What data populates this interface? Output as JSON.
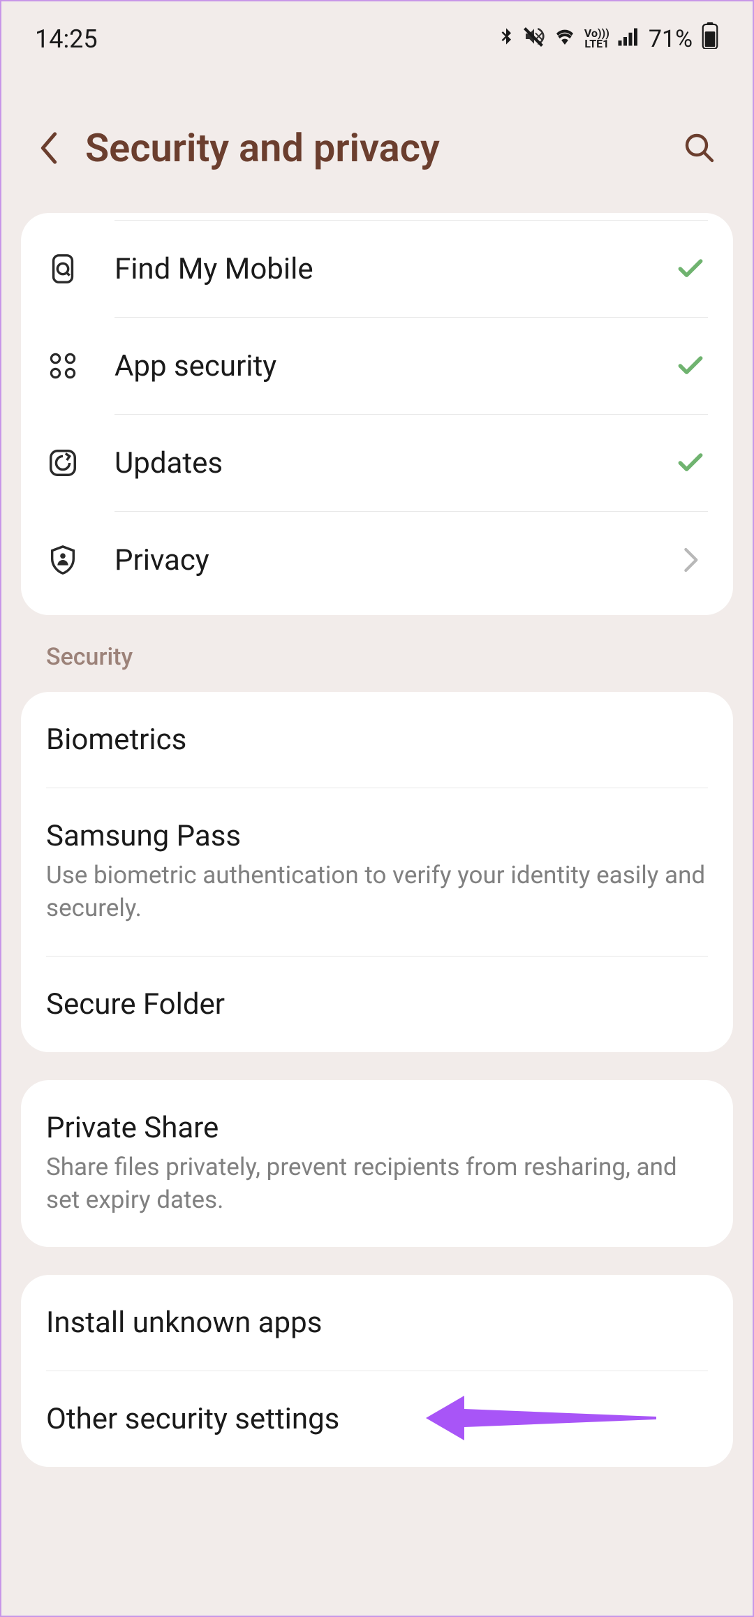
{
  "statusBar": {
    "time": "14:25",
    "battery": "71%"
  },
  "header": {
    "title": "Security and privacy"
  },
  "card1": {
    "items": [
      {
        "label": "Find My Mobile",
        "icon": "find-mobile",
        "status": "check"
      },
      {
        "label": "App security",
        "icon": "apps",
        "status": "check"
      },
      {
        "label": "Updates",
        "icon": "updates",
        "status": "check"
      },
      {
        "label": "Privacy",
        "icon": "privacy",
        "status": "chevron"
      }
    ]
  },
  "sectionHeader": "Security",
  "card2": {
    "items": [
      {
        "label": "Biometrics",
        "desc": ""
      },
      {
        "label": "Samsung Pass",
        "desc": "Use biometric authentication to verify your identity easily and securely."
      },
      {
        "label": "Secure Folder",
        "desc": ""
      }
    ]
  },
  "card3": {
    "items": [
      {
        "label": "Private Share",
        "desc": "Share files privately, prevent recipients from resharing, and set expiry dates."
      }
    ]
  },
  "card4": {
    "items": [
      {
        "label": "Install unknown apps",
        "desc": ""
      },
      {
        "label": "Other security settings",
        "desc": ""
      }
    ]
  }
}
